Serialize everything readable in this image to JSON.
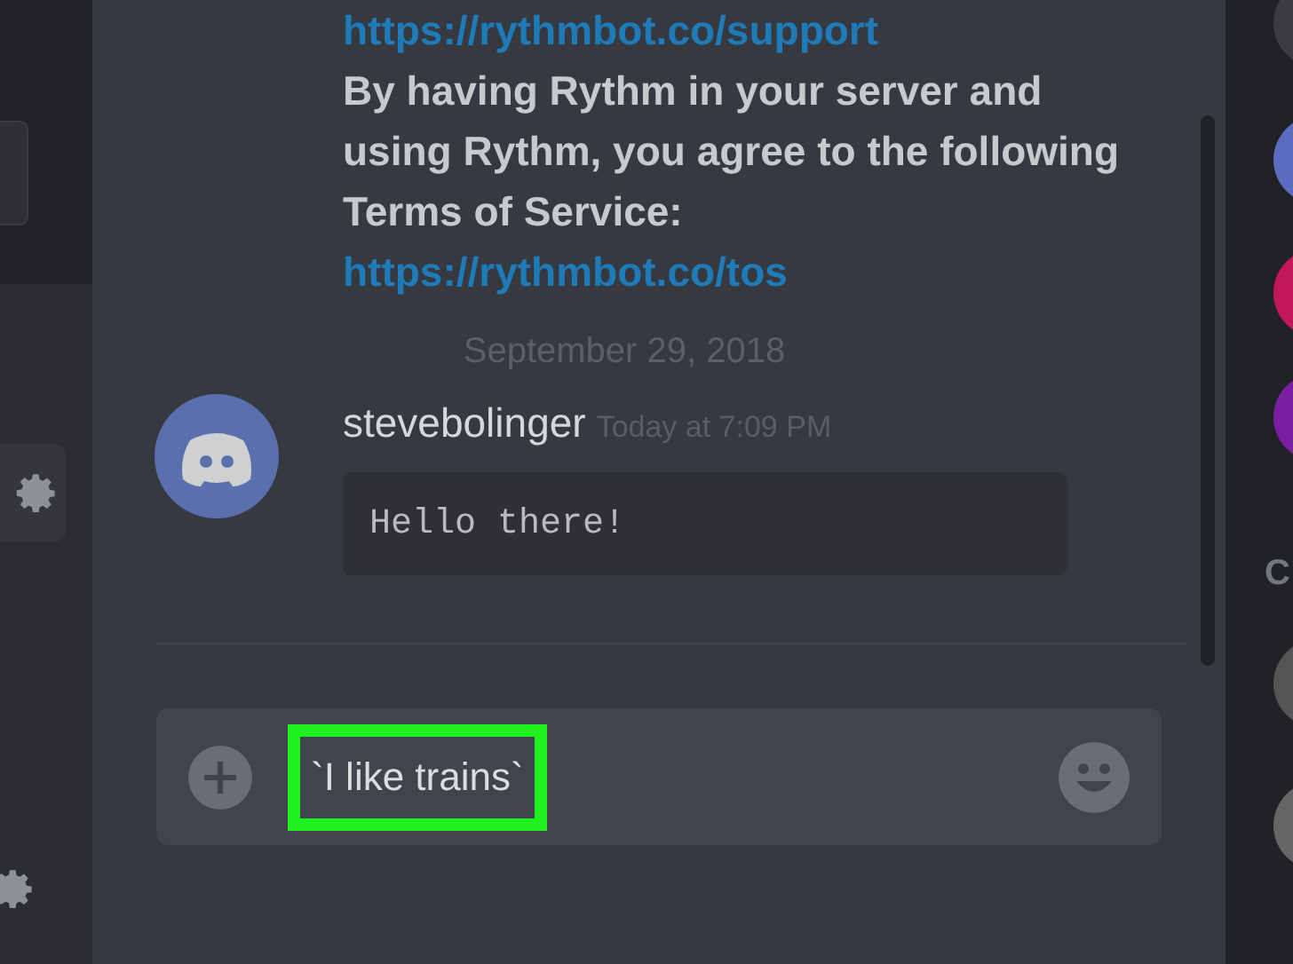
{
  "bot_message": {
    "link_support": "https://rythmbot.co/support",
    "notice": "By having Rythm in your server and using Rythm, you agree to the following Terms of Service:",
    "link_tos": "https://rythmbot.co/tos"
  },
  "date_divider": "September 29, 2018",
  "message": {
    "author": "stevebolinger",
    "timestamp": "Today at 7:09 PM",
    "code": "Hello there!"
  },
  "composer": {
    "value": "`I like trains`"
  },
  "members": {
    "heading": "C"
  }
}
